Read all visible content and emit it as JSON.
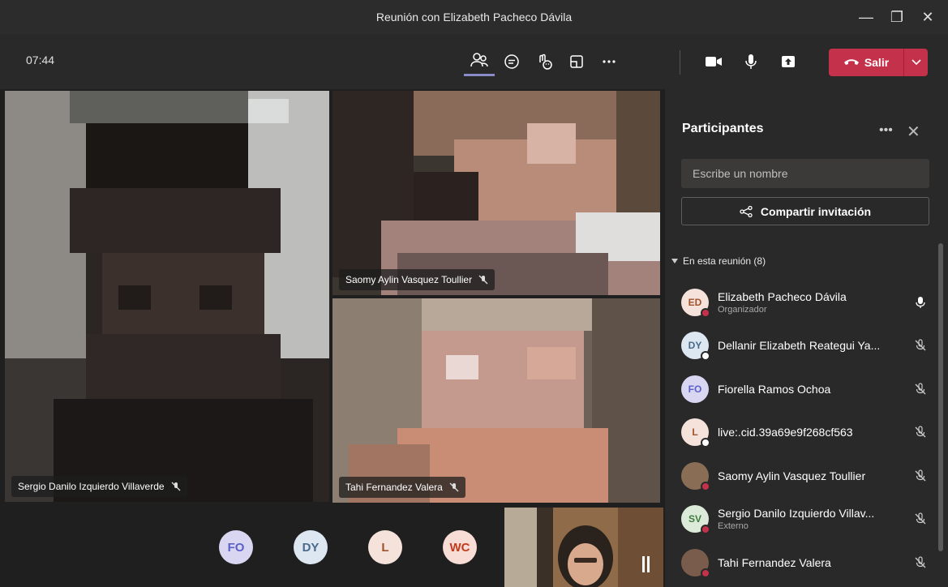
{
  "window": {
    "title": "Reunión con Elizabeth Pacheco Dávila"
  },
  "toolbar": {
    "clock": "07:44",
    "icons": [
      "participants-icon",
      "chat-icon",
      "reactions-icon",
      "rooms-icon",
      "more-icon"
    ],
    "media": [
      "camera-icon",
      "microphone-icon",
      "share-icon"
    ],
    "leave_label": "Salir"
  },
  "stage": {
    "tiles": [
      {
        "name": "Sergio Danilo Izquierdo Villaverde"
      },
      {
        "name": "Saomy Aylin Vasquez Toullier"
      },
      {
        "name": "Tahi Fernandez Valera"
      }
    ],
    "overflow_avatars": [
      {
        "initials": "FO",
        "color": "#d8d6f0",
        "text": "#5b5fc7"
      },
      {
        "initials": "DY",
        "color": "#dce7f2",
        "text": "#4a6a8a"
      },
      {
        "initials": "L",
        "color": "#f5e3db",
        "text": "#a0522d"
      },
      {
        "initials": "WC",
        "color": "#f7ddd6",
        "text": "#c23a1b"
      }
    ]
  },
  "panel": {
    "title": "Participantes",
    "search_placeholder": "Escribe un nombre",
    "invite_label": "Compartir invitación",
    "section_label": "En esta reunión (8)",
    "participants": [
      {
        "initials": "ED",
        "name": "Elizabeth Pacheco Dávila",
        "role": "Organizador",
        "avatar_bg": "#f5e3db",
        "avatar_fg": "#a0522d",
        "status": "#c4314b",
        "mic": "on"
      },
      {
        "initials": "DY",
        "name": "Dellanir Elizabeth Reategui Ya...",
        "role": "",
        "avatar_bg": "#dce7f2",
        "avatar_fg": "#4a6a8a",
        "status": "#ffffff",
        "mic": "off"
      },
      {
        "initials": "FO",
        "name": "Fiorella Ramos Ochoa",
        "role": "",
        "avatar_bg": "#d8d6f0",
        "avatar_fg": "#5b5fc7",
        "status": "",
        "mic": "off"
      },
      {
        "initials": "L",
        "name": "live:.cid.39a69e9f268cf563",
        "role": "",
        "avatar_bg": "#f5e3db",
        "avatar_fg": "#a0522d",
        "status": "#ffffff",
        "mic": "off"
      },
      {
        "initials": "",
        "name": "Saomy Aylin Vasquez Toullier",
        "role": "",
        "avatar_bg": "#8a6d55",
        "avatar_fg": "#ffffff",
        "status": "#c4314b",
        "mic": "off"
      },
      {
        "initials": "SV",
        "name": "Sergio Danilo Izquierdo Villav...",
        "role": "Externo",
        "avatar_bg": "#dcebd9",
        "avatar_fg": "#3d7a3d",
        "status": "#c4314b",
        "mic": "off"
      },
      {
        "initials": "",
        "name": "Tahi Fernandez Valera",
        "role": "",
        "avatar_bg": "#7a5c4c",
        "avatar_fg": "#ffffff",
        "status": "#c4314b",
        "mic": "off"
      }
    ]
  }
}
